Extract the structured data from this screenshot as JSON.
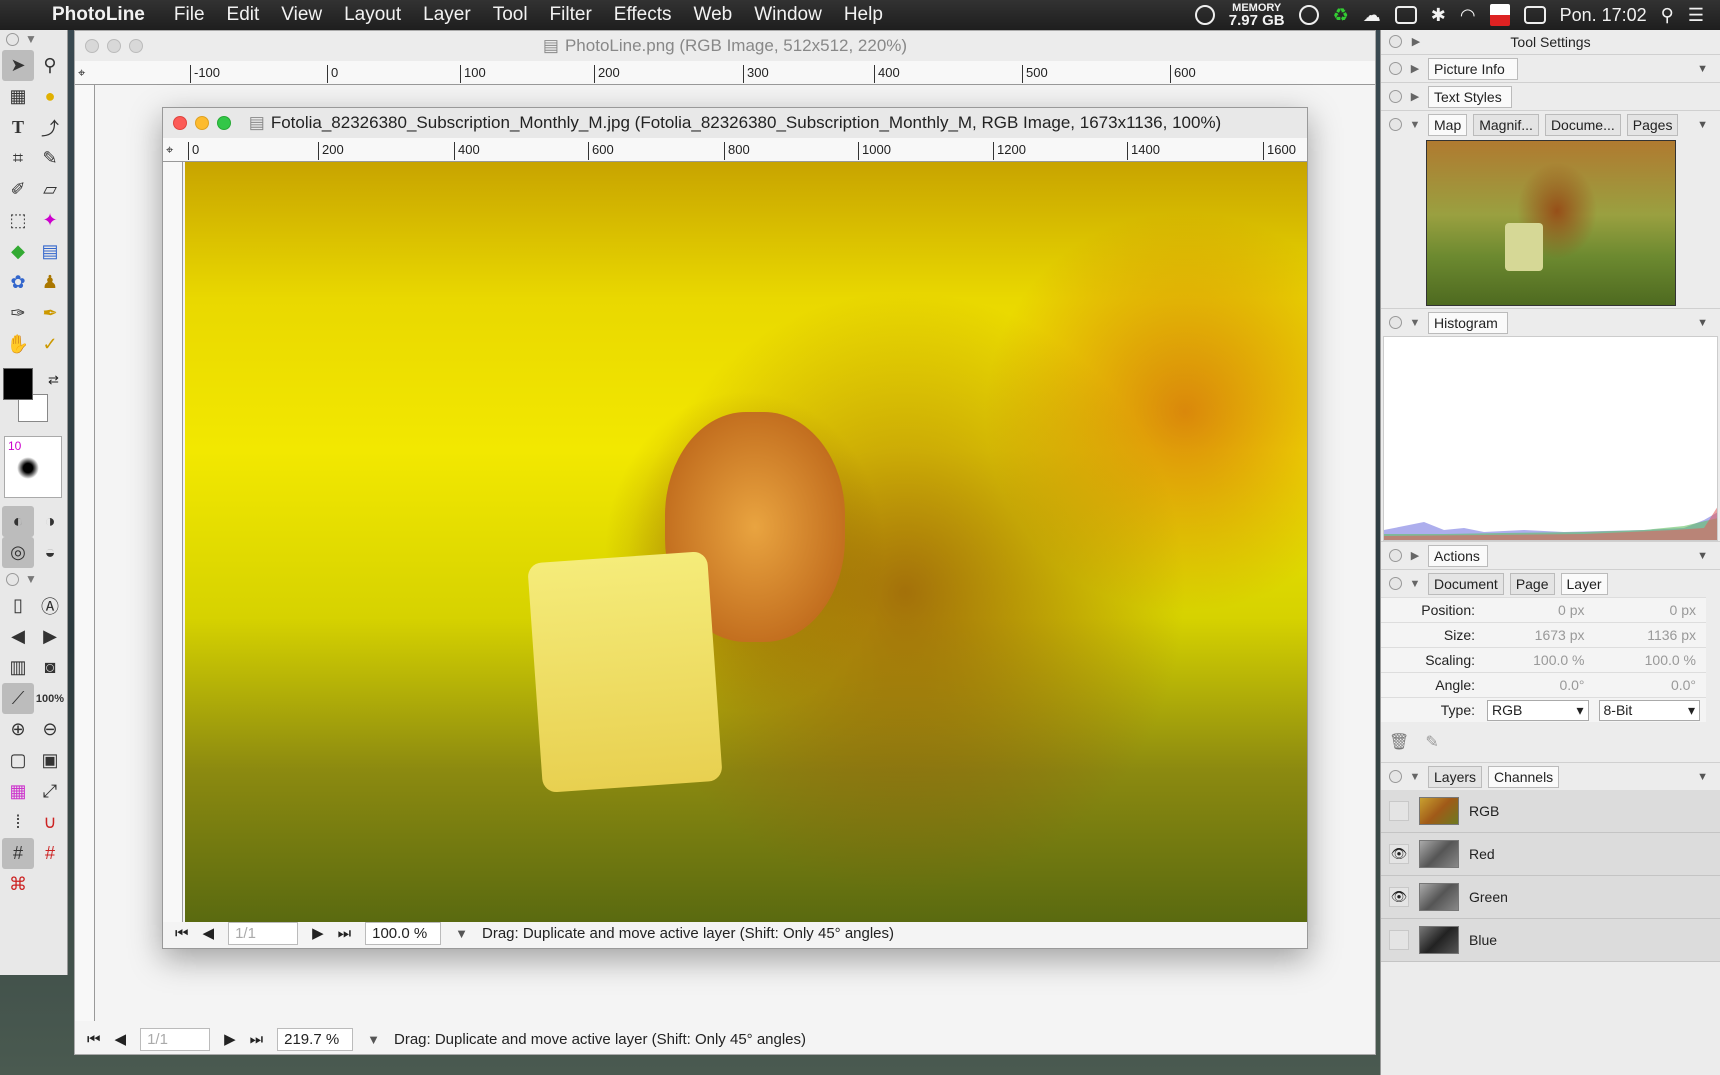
{
  "menubar": {
    "app": "PhotoLine",
    "items": [
      "File",
      "Edit",
      "View",
      "Layout",
      "Layer",
      "Tool",
      "Filter",
      "Effects",
      "Web",
      "Window",
      "Help"
    ],
    "memory_label": "MEMORY",
    "memory_value": "7.97 GB",
    "clock": "Pon. 17:02"
  },
  "toolbox": {
    "brush_size": "10",
    "zoom_100": "100%"
  },
  "back_window": {
    "title": "PhotoLine.png (RGB Image, 512x512, 220%)",
    "ruler_labels": [
      "-100",
      "0",
      "100",
      "200",
      "300",
      "400",
      "500",
      "600"
    ],
    "page_field": "1/1",
    "zoom": "219.7 %",
    "status": "Drag: Duplicate and move active layer (Shift: Only 45° angles)"
  },
  "front_window": {
    "title": "Fotolia_82326380_Subscription_Monthly_M.jpg (Fotolia_82326380_Subscription_Monthly_M, RGB Image, 1673x1136, 100%)",
    "ruler_labels": [
      "0",
      "200",
      "400",
      "600",
      "800",
      "1000",
      "1200",
      "1400",
      "1600"
    ],
    "page_field": "1/1",
    "zoom": "100.0 %",
    "status": "Drag: Duplicate and move active layer (Shift: Only 45° angles)"
  },
  "panels": {
    "tool_settings": "Tool Settings",
    "picture_info": "Picture Info",
    "text_styles": "Text Styles",
    "map_tabs": [
      "Map",
      "Magnif...",
      "Docume...",
      "Pages"
    ],
    "histogram": "Histogram",
    "actions": "Actions",
    "prop_tabs": [
      "Document",
      "Page",
      "Layer"
    ],
    "props": {
      "position_label": "Position:",
      "position_x": "0 px",
      "position_y": "0 px",
      "size_label": "Size:",
      "size_w": "1673 px",
      "size_h": "1136 px",
      "scaling_label": "Scaling:",
      "scaling_x": "100.0 %",
      "scaling_y": "100.0 %",
      "angle_label": "Angle:",
      "angle_a": "0.0°",
      "angle_b": "0.0°",
      "type_label": "Type:",
      "type_value": "RGB",
      "depth_value": "8-Bit"
    },
    "layer_tabs": [
      "Layers",
      "Channels"
    ],
    "channels": [
      {
        "name": "RGB",
        "visible": false
      },
      {
        "name": "Red",
        "visible": true
      },
      {
        "name": "Green",
        "visible": true
      },
      {
        "name": "Blue",
        "visible": false
      }
    ]
  }
}
